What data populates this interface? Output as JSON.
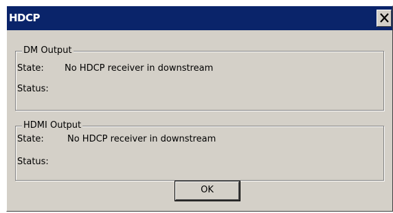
{
  "dialog": {
    "title": "HDCP",
    "close_glyph": "×",
    "ok_label": "OK"
  },
  "groups": {
    "dm_output": {
      "label": "DM Output",
      "state_label": "State:",
      "state_value": "No HDCP receiver in downstream",
      "status_label": "Status:",
      "status_value": ""
    },
    "hdmi_output": {
      "label": "HDMI Output",
      "state_label": "State:",
      "state_value": "No HDCP receiver in downstream",
      "status_label": "Status:",
      "status_value": ""
    }
  },
  "colors": {
    "titlebar": "#0a246a",
    "face": "#d4d0c8",
    "title_text": "#ffffff"
  },
  "icons": {
    "close": "close-x-icon"
  }
}
